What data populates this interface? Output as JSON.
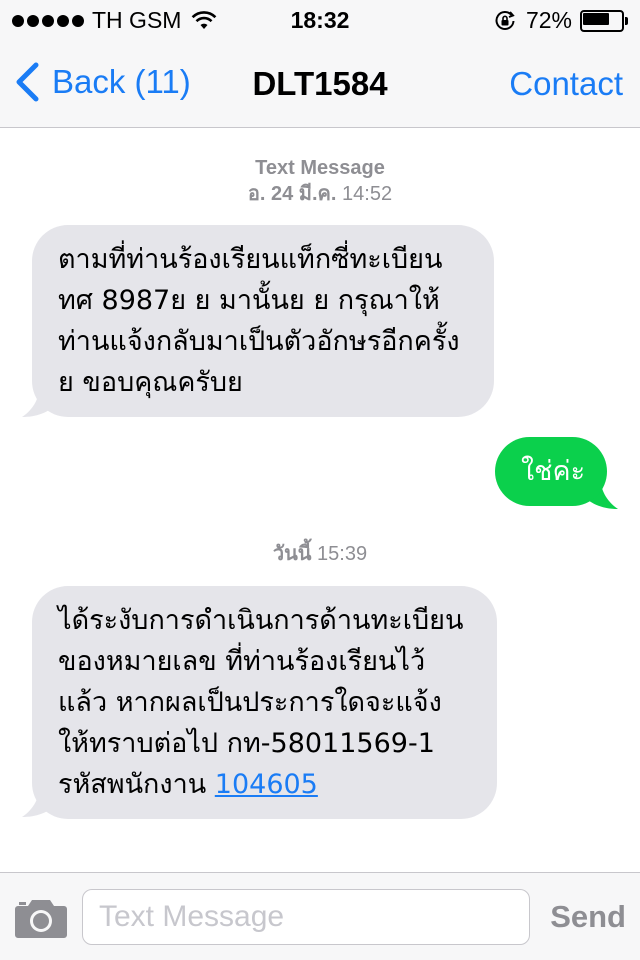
{
  "status_bar": {
    "signal_strength_dots": 5,
    "carrier": "TH GSM",
    "time": "18:32",
    "battery_percent_label": "72%",
    "battery_level": 0.72,
    "icons": [
      "signal-dots",
      "wifi-icon",
      "rotation-lock-icon",
      "battery-icon"
    ]
  },
  "nav": {
    "back_label": "Back (11)",
    "title": "DLT1584",
    "contact_label": "Contact",
    "accent_color": "#1a7cf5"
  },
  "thread": {
    "stamp1": {
      "label": "Text Message",
      "day": "อ. 24 มี.ค.",
      "time": "14:52"
    },
    "message1": {
      "direction": "incoming",
      "lines": [
        "ตามที่ท่านร้องเรียนแท็กซี่ทะเบียน",
        "ทศ 8987ย ย มานั้นย ย กรุณาให้",
        "ท่านแจ้งกลับมาเป็นตัวอักษรอีกครั้ง",
        "ย ขอบคุณครับย"
      ]
    },
    "message2": {
      "direction": "outgoing",
      "text": "ใช่ค่ะ",
      "bubble_color": "#0bd04c"
    },
    "stamp2": {
      "day": "วันนี้",
      "time": "15:39"
    },
    "message3": {
      "direction": "incoming",
      "lines": [
        "ได้ระงับการดำเนินการด้านทะเบียน",
        "ของหมายเลข ที่ท่านร้องเรียนไว้",
        "แล้ว หากผลเป็นประการใดจะแจ้ง",
        "ให้ทราบต่อไป กท-58011569-1"
      ],
      "last_line_prefix": "รหัสพนักงาน ",
      "last_line_link": "104605"
    }
  },
  "input_bar": {
    "placeholder": "Text Message",
    "send_label": "Send"
  }
}
